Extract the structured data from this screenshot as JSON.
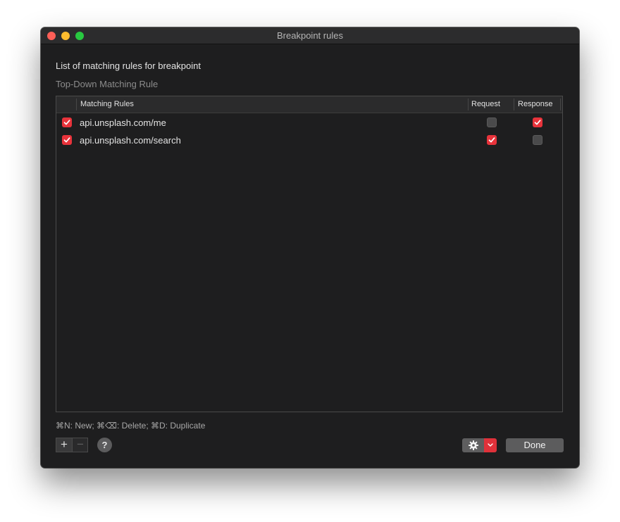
{
  "window": {
    "title": "Breakpoint rules"
  },
  "heading": "List of matching rules for breakpoint",
  "subheading": "Top-Down Matching Rule",
  "table": {
    "columns": {
      "rule": "Matching Rules",
      "request": "Request",
      "response": "Response"
    },
    "rows": [
      {
        "enabled": true,
        "pattern": "api.unsplash.com/me",
        "request": false,
        "response": true
      },
      {
        "enabled": true,
        "pattern": "api.unsplash.com/search",
        "request": true,
        "response": false
      }
    ]
  },
  "hint": "⌘N: New; ⌘⌫: Delete; ⌘D: Duplicate",
  "buttons": {
    "add": "+",
    "remove": "−",
    "help": "?",
    "settings_icon": "gear-icon",
    "dropdown_icon": "chevron-down-icon",
    "done": "Done"
  },
  "colors": {
    "accent": "#e8333b",
    "background": "#1e1e1f",
    "titlebar": "#2c2c2d"
  }
}
